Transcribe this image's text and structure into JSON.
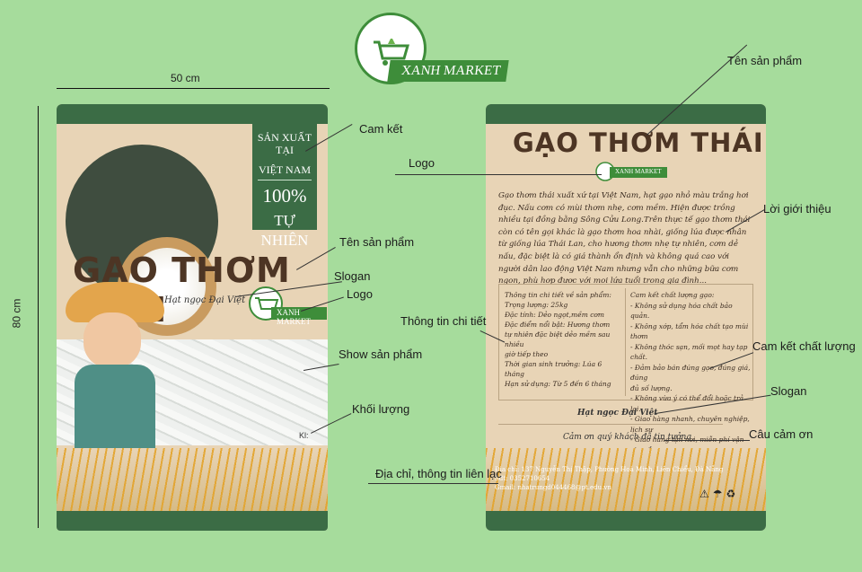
{
  "brand": {
    "logo_text": "XANH MARKET"
  },
  "dimensions": {
    "width_label": "50 cm",
    "height_label": "80 cm"
  },
  "front": {
    "badge_line1": "SẢN XUẤT TẠI",
    "badge_line2": "VIỆT NAM",
    "badge_percent": "100%",
    "badge_natural": "TỰ NHIÊN",
    "title": "GẠO THƠM THÁI",
    "slogan": "Hạt ngọc Đại Việt",
    "small_logo": "XANH MARKET",
    "weight": "Kl:"
  },
  "back": {
    "title": "GẠO THƠM THÁI",
    "small_logo": "XANH MARKET",
    "intro": "Gạo thơm thái xuất xứ tại Việt Nam, hạt gạo nhỏ màu trắng hơi đục. Nấu cơm có mùi thơm nhẹ, cơm mềm. Hiện được trồng nhiều tại đồng bằng Sông Cửu Long.Trên thực tế gạo thơm thái còn có tên gọi khác là gạo thơm hoa nhài, giống lúa được nhân từ giống lúa Thái Lan, cho hương thơm nhẹ tự nhiên, cơm dẻ nấu, đặc biệt là có giá thành ổn định và không quá cao với người dân lao động Việt Nam nhưng vẫn cho những bữa cơm ngon, phù hợp được với mọi lứa tuổi trong gia đình...",
    "info_title": "Thông tin chi tiết về sản phẩm:",
    "info_lines": [
      "Trọng lượng:              25kg",
      "Đặc tính: Dẻo ngọt,mềm cơm",
      "Đặc điểm nổi bật:      Hương   thơm",
      "tự nhiên đặc biệt dẻo mềm sau nhiều",
      "giờ tiếp theo",
      "Thời gian sinh trưởng: Lúa 6 tháng",
      "Hạn sử dụng: Từ 5 đến 6 tháng"
    ],
    "quality_title": "Cam kết chất lượng gạo:",
    "quality_lines": [
      "- Không sử dụng hóa chất bảo quản.",
      "- Không xớp, tẩm hóa chất tạo mùi thơm",
      "- Không thóc sạn, mối mọt hay tạp chất.",
      "- Đảm bảo bán đúng gạo, đúng giá, đúng",
      "đủ số lượng.",
      "- Không vừa ý có thể đổi hoặc trả lại.",
      "- Giao hàng nhanh, chuyên nghiệp, lịch sự",
      "- Giao hàng tận nơi, miễn phí vận chuyển"
    ],
    "slogan": "Hạt ngọc Đại Việt",
    "thanks": "Cảm ơn quý khách đã tin tưởng",
    "address_line": "Địa chỉ: 137 Nguyễn Thị Thập, Phường Hoà Minh, Liên Chiểu, Đà Nẵng",
    "phone_line": "Sđt: 0352710654",
    "email_line": "Gmail: nhatrungd044468@pt.edu.vn",
    "icons": "⚠☂♻"
  },
  "callouts": {
    "cam_ket": "Cam kết",
    "ten_san_pham_top": "Tên sản phẩm",
    "logo_back": "Logo",
    "loi_gioi_thieu": "Lời giới thiệu",
    "ten_san_pham_front": "Tên sản phẩm",
    "slogan_front": "Slogan",
    "logo_front": "Logo",
    "thong_tin_chi_tiet": "Thông tin chi tiết",
    "show_san_pham": "Show sản phẩm",
    "cam_ket_chat_luong": "Cam kết chất lượng",
    "slogan_back": "Slogan",
    "khoi_luong": "Khối lượng",
    "cau_cam_on": "Câu cảm ơn",
    "dia_chi": "Địa chỉ, thông tin liên lạc"
  }
}
